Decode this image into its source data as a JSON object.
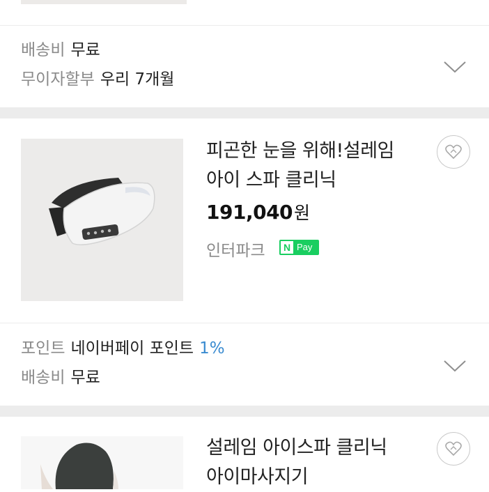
{
  "previous_item": {
    "shipping_label": "배송비",
    "shipping_value": "무료",
    "installment_label": "무이자할부",
    "installment_value": "우리 7개월"
  },
  "products": [
    {
      "title_line1": "피곤한 눈을 위해!설레임",
      "title_line2": "아이 스파 클리닉",
      "price": "191,040",
      "currency": "원",
      "mall": "인터파크",
      "npay_n": "N",
      "npay_pay": "Pay",
      "point_label": "포인트",
      "point_value": "네이버페이 포인트",
      "point_pct": "1%",
      "shipping_label": "배송비",
      "shipping_value": "무료",
      "icon": "heart-icon"
    },
    {
      "title_line1": "설레임 아이스파 클리닉",
      "title_line2": "아이마사지기",
      "icon": "heart-icon"
    }
  ],
  "colors": {
    "npay_green": "#19ce60",
    "point_blue": "#3a8bd0",
    "muted_gray": "#8a8a8a"
  }
}
